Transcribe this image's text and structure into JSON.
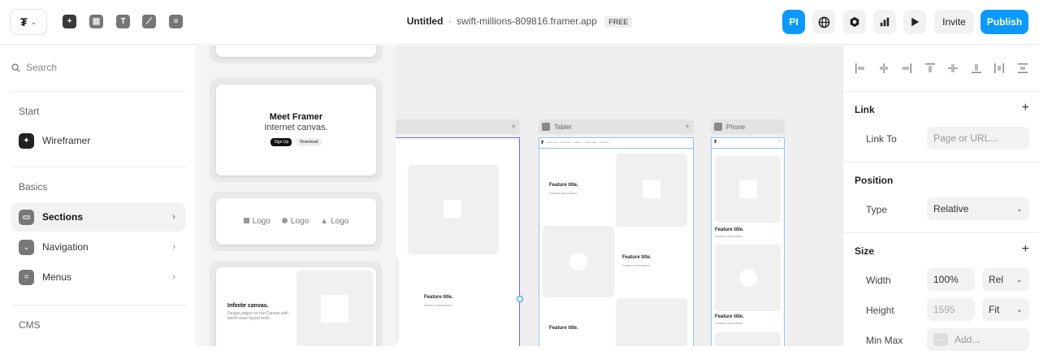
{
  "topbar": {
    "logo_glyph": "₮",
    "logo_caret": "⌄",
    "tools": [
      {
        "name": "insert",
        "glyph": "+"
      },
      {
        "name": "layout",
        "glyph": "▥"
      },
      {
        "name": "text",
        "glyph": "T"
      },
      {
        "name": "vector",
        "glyph": "⟋"
      },
      {
        "name": "cms",
        "glyph": "≡"
      }
    ],
    "title": "Untitled",
    "separator": "·",
    "domain": "swift-millions-809816.framer.app",
    "badge": "FREE",
    "avatar": "PI",
    "invite": "Invite",
    "publish": "Publish"
  },
  "left_panel": {
    "search_placeholder": "Search",
    "sections": [
      {
        "label": "Start",
        "items": [
          {
            "label": "Wireframer",
            "icon": "sparkle-icon"
          }
        ]
      },
      {
        "label": "Basics",
        "items": [
          {
            "label": "Sections",
            "icon": "section-icon",
            "active": true
          },
          {
            "label": "Navigation",
            "icon": "navigation-icon"
          },
          {
            "label": "Menus",
            "icon": "menu-icon"
          }
        ]
      },
      {
        "label": "CMS",
        "items": []
      }
    ]
  },
  "insert_panel": {
    "hero_card": {
      "title": "Meet Framer",
      "subtitle": "Internet canvas.",
      "primary": "Sign Up",
      "secondary": "Download"
    },
    "logos_card": {
      "logos": [
        "Logo",
        "Logo",
        "Logo"
      ]
    },
    "feature_card": {
      "title": "Infinite canvas.",
      "text": "Design pages on our Canvas with world-class layout tools."
    }
  },
  "canvas": {
    "frames": [
      {
        "label": "Tablet"
      },
      {
        "label": "Phone"
      }
    ],
    "feature_title": "Feature title.",
    "feature_desc": "Feature description.",
    "nav_links": [
      "Personas",
      "Personas",
      "Gallery",
      "Personatis",
      "Updates"
    ]
  },
  "right_panel": {
    "align_icons": [
      "align-left-icon",
      "align-center-h-icon",
      "align-right-icon",
      "align-top-icon",
      "align-middle-icon",
      "align-bottom-icon",
      "distribute-h-icon",
      "distribute-v-icon"
    ],
    "link": {
      "heading": "Link",
      "label": "Link To",
      "placeholder": "Page or URL..."
    },
    "position": {
      "heading": "Position",
      "label": "Type",
      "value": "Relative"
    },
    "size": {
      "heading": "Size",
      "width_label": "Width",
      "width_value": "100%",
      "width_unit": "Rel",
      "height_label": "Height",
      "height_value": "1595",
      "height_unit": "Fit",
      "minmax_label": "Min Max",
      "minmax_value": "Add..."
    },
    "colors": {
      "accent": "#0a99ff",
      "frame_outline": "#8fc6ee",
      "selection": "#7b61ff"
    }
  }
}
